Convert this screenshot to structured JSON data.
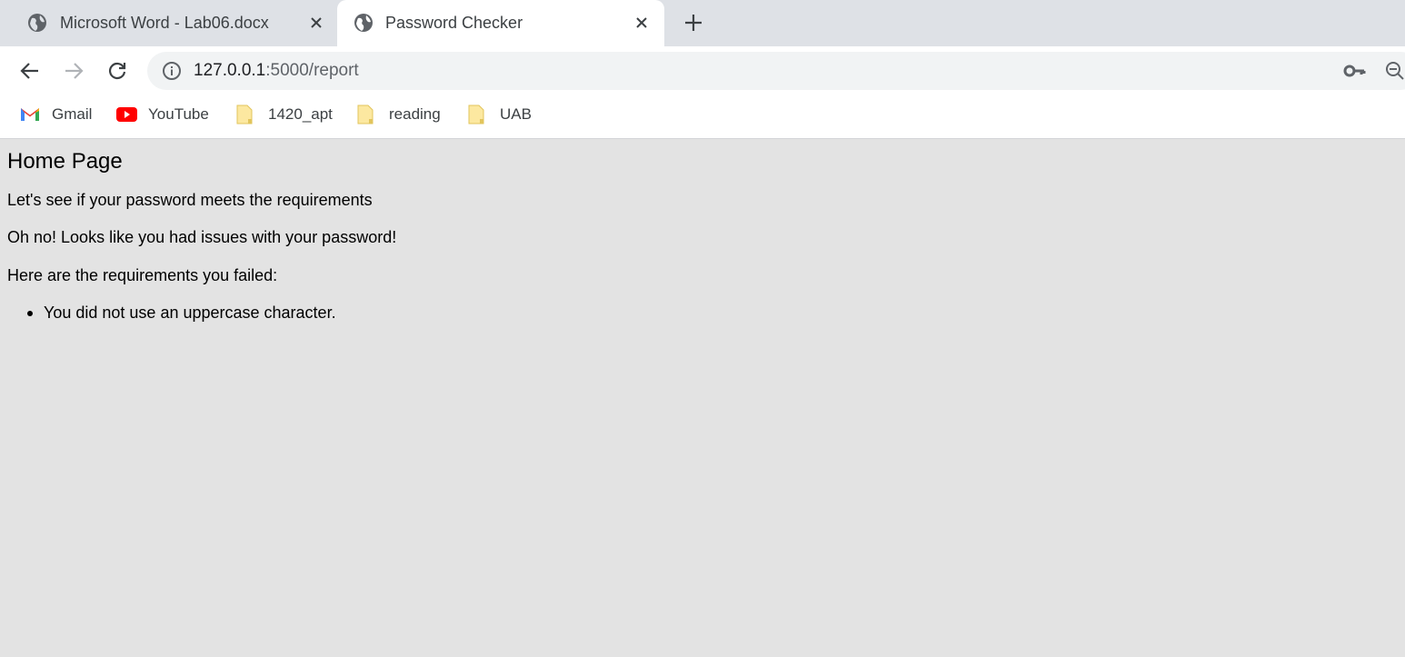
{
  "browser": {
    "tabs": [
      {
        "title": "Microsoft Word - Lab06.docx",
        "icon": "globe-icon",
        "active": false
      },
      {
        "title": "Password Checker",
        "icon": "globe-icon",
        "active": true
      }
    ],
    "address_bar": {
      "host": "127.0.0.1",
      "path": ":5000/report"
    },
    "bookmarks": [
      {
        "label": "Gmail",
        "icon": "gmail-icon"
      },
      {
        "label": "YouTube",
        "icon": "youtube-icon"
      },
      {
        "label": "1420_apt",
        "icon": "folder-icon"
      },
      {
        "label": "reading",
        "icon": "folder-icon"
      },
      {
        "label": "UAB",
        "icon": "folder-icon"
      }
    ]
  },
  "page": {
    "heading": "Home Page",
    "intro": "Let's see if your password meets the requirements",
    "status": "Oh no! Looks like you had issues with your password!",
    "failed_header": "Here are the requirements you failed:",
    "failures": [
      "You did not use an uppercase character."
    ]
  },
  "colors": {
    "page_background": "#e3e3e3",
    "tabstrip": "#dee1e6",
    "omnibox": "#f1f3f4",
    "folder": "#fce8a0",
    "youtube": "#ff0000"
  }
}
